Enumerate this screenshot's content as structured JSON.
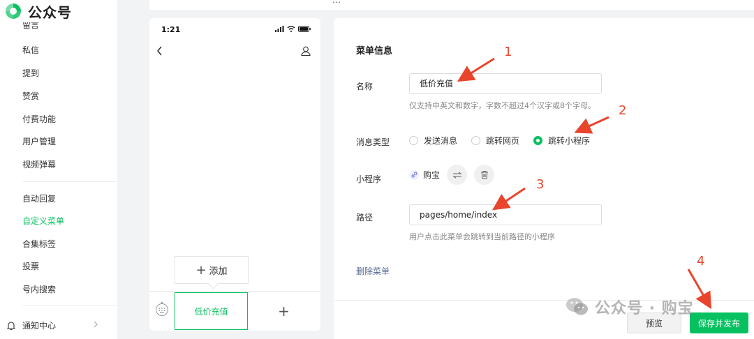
{
  "app": {
    "title": "公众号"
  },
  "top_strip": {
    "text": "…"
  },
  "sidebar": {
    "clipped_item": "留言",
    "items": [
      {
        "label": "私信"
      },
      {
        "label": "提到"
      },
      {
        "label": "赞赏"
      },
      {
        "label": "付费功能"
      },
      {
        "label": "用户管理"
      },
      {
        "label": "视频弹幕"
      },
      {
        "label": "自动回复"
      },
      {
        "label": "自定义菜单",
        "active": true
      },
      {
        "label": "合集标签"
      },
      {
        "label": "投票"
      },
      {
        "label": "号内搜索"
      }
    ],
    "notification_label": "通知中心"
  },
  "phone": {
    "time": "1:21",
    "add_popup_label": "添加",
    "active_menu_label": "低价充值",
    "add_menu_symbol": "+"
  },
  "form": {
    "title": "菜单信息",
    "name_label": "名称",
    "name_value": "低价充值",
    "name_hint": "仅支持中英文和数字，字数不超过4个汉字或8个字母。",
    "msg_type_label": "消息类型",
    "msg_type_options": [
      "发送消息",
      "跳转网页",
      "跳转小程序"
    ],
    "msg_type_selected": "跳转小程序",
    "miniprogram_label": "小程序",
    "miniprogram_name": "购宝",
    "path_label": "路径",
    "path_value": "pages/home/index",
    "path_hint": "用户点击此菜单会跳转到当前路径的小程序",
    "delete_label": "删除菜单",
    "preview_button": "预览",
    "save_button": "保存并发布"
  },
  "annotations": [
    "1",
    "2",
    "3",
    "4"
  ],
  "watermark": "公众号 · 购宝",
  "colors": {
    "accent": "#07c160",
    "link": "#576b95",
    "annotation": "#e8452c"
  }
}
